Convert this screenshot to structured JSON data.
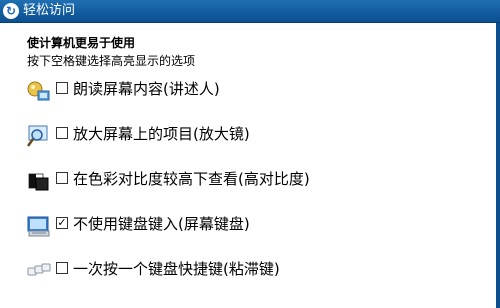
{
  "window": {
    "title": "轻松访问"
  },
  "heading": "使计算机更易于使用",
  "subheading": "按下空格键选择高亮显示的选项",
  "options": [
    {
      "icon": "narrator-icon",
      "checked": false,
      "label": "朗读屏幕内容(讲述人)"
    },
    {
      "icon": "magnifier-icon",
      "checked": false,
      "label": "放大屏幕上的项目(放大镜)"
    },
    {
      "icon": "high-contrast-icon",
      "checked": false,
      "label": "在色彩对比度较高下查看(高对比度)"
    },
    {
      "icon": "on-screen-keyboard-icon",
      "checked": true,
      "label": "不使用键盘键入(屏幕键盘)"
    },
    {
      "icon": "sticky-keys-icon",
      "checked": false,
      "label": "一次按一个键盘快捷键(粘滞键)"
    }
  ],
  "checkmark": "✓"
}
